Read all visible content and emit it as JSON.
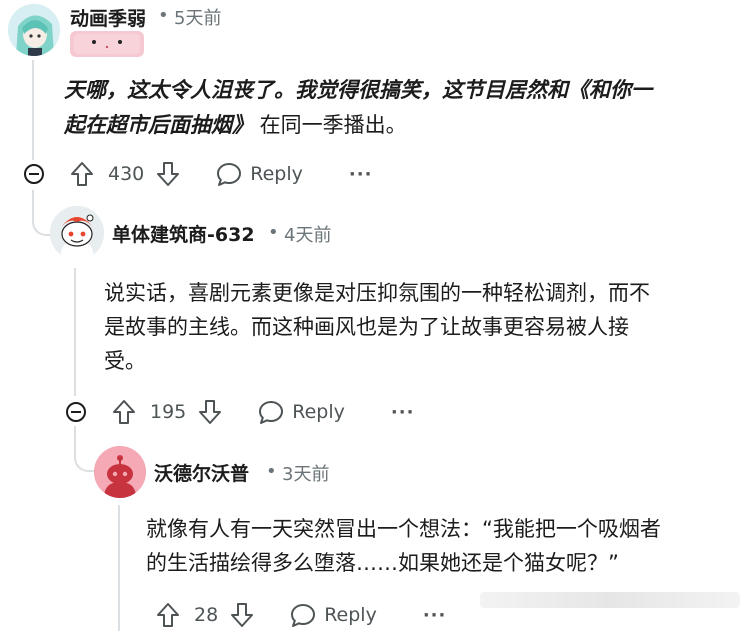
{
  "comments": [
    {
      "author": "动画季弱",
      "time": "5天前",
      "separator": "•",
      "body_bold": "天哪，这太令人沮丧了。我觉得很搞笑，这节目居然和《和你一起在超市后面抽烟》",
      "body_line1": "天哪，这太令人沮丧了。我觉得很搞笑，这节目居然和《和你一",
      "body_line2_bold": "起在超市后面抽烟》",
      "body_line2_rest": " 在同一季播出。",
      "votes": "430",
      "reply_label": "Reply",
      "more_label": "···"
    },
    {
      "author": "单体建筑商-632",
      "time": "4天前",
      "separator": "•",
      "body_lines": [
        "说实话，喜剧元素更像是对压抑氛围的一种轻松调剂，而不",
        "是故事的主线。而这种画风也是为了让故事更容易被人接",
        "受。"
      ],
      "votes": "195",
      "reply_label": "Reply",
      "more_label": "···"
    },
    {
      "author": "沃德尔沃普",
      "time": "3天前",
      "separator": "•",
      "body_lines": [
        "就像有人有一天突然冒出一个想法：“我能把一个吸烟者",
        "的生活描绘得多么堕落……如果她还是个猫女呢？”"
      ],
      "votes": "28",
      "reply_label": "Reply",
      "more_label": "···"
    }
  ],
  "colors": {
    "accent_pink": "#f4a9b4",
    "text": "#1c1c1c",
    "meta": "#6b7478",
    "line": "#dcdfe2"
  }
}
